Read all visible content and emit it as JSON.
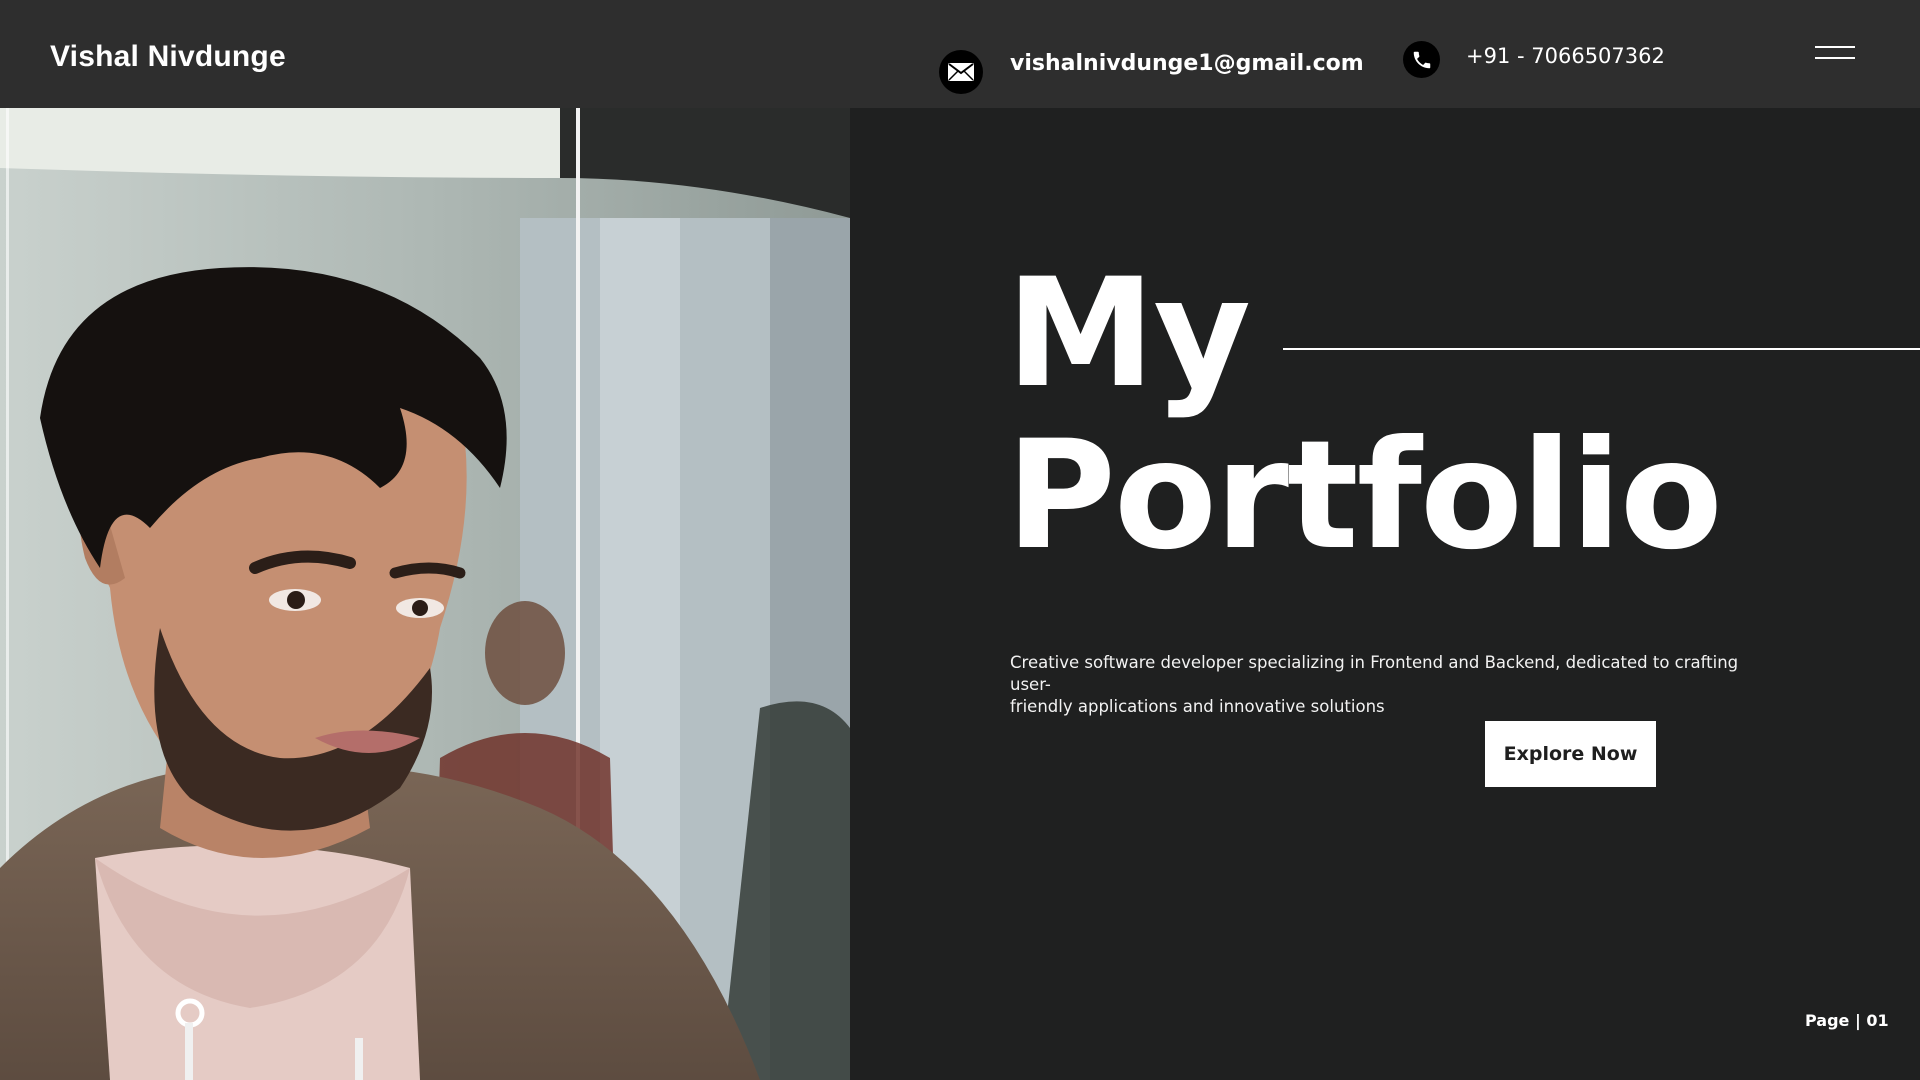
{
  "header": {
    "brand": "Vishal Nivdunge",
    "email": "vishalnivdunge1@gmail.com",
    "phone": "+91 - 7066507362",
    "icons": {
      "email": "mail-icon",
      "phone": "phone-icon",
      "menu": "hamburger-menu-icon"
    }
  },
  "hero": {
    "title_line1": "My",
    "title_line2": "Portfolio",
    "tagline_line1": "Creative software developer specializing in Frontend and Backend, dedicated to crafting user-",
    "tagline_line2": "friendly applications and innovative solutions",
    "cta_label": "Explore Now"
  },
  "footer": {
    "page_label": "Page | 01"
  },
  "colors": {
    "header_bg": "#2e2e2e",
    "page_bg": "#1f2020",
    "text": "#ffffff",
    "button_bg": "#ffffff",
    "button_text": "#1f1f1f"
  }
}
